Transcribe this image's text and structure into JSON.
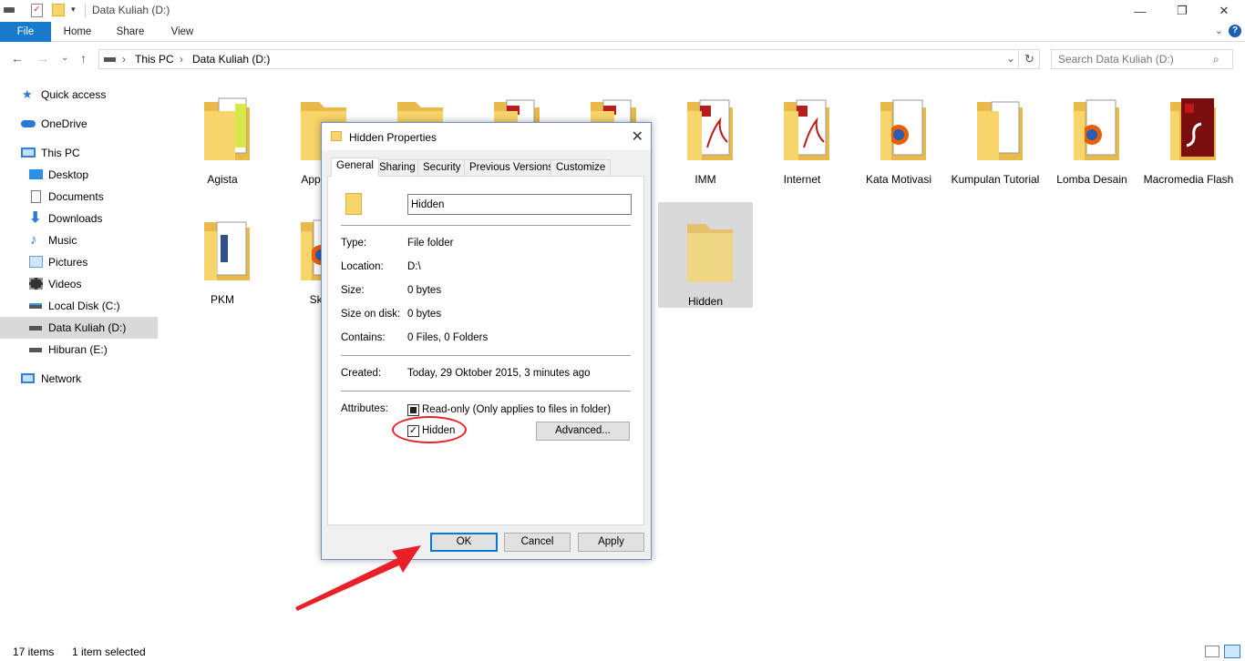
{
  "window": {
    "title": "Data Kuliah (D:)"
  },
  "ribbon": {
    "tabs": [
      "File",
      "Home",
      "Share",
      "View"
    ]
  },
  "address": {
    "crumbs": [
      "This PC",
      "Data Kuliah (D:)"
    ],
    "search_placeholder": "Search Data Kuliah (D:)"
  },
  "sidebar": {
    "items": [
      {
        "label": "Quick access",
        "icon": "star-icon"
      },
      {
        "label": "OneDrive",
        "icon": "cloud-icon"
      },
      {
        "label": "This PC",
        "icon": "computer-icon"
      },
      {
        "label": "Desktop",
        "icon": "desktop-icon"
      },
      {
        "label": "Documents",
        "icon": "documents-icon"
      },
      {
        "label": "Downloads",
        "icon": "download-icon"
      },
      {
        "label": "Music",
        "icon": "music-icon"
      },
      {
        "label": "Pictures",
        "icon": "pictures-icon"
      },
      {
        "label": "Videos",
        "icon": "videos-icon"
      },
      {
        "label": "Local Disk (C:)",
        "icon": "drive-icon"
      },
      {
        "label": "Data Kuliah (D:)",
        "icon": "drive-icon"
      },
      {
        "label": "Hiburan (E:)",
        "icon": "drive-icon"
      },
      {
        "label": "Network",
        "icon": "network-icon"
      }
    ],
    "selected": "Data Kuliah (D:)"
  },
  "files": [
    {
      "name": "Agista"
    },
    {
      "name": "Applica"
    },
    {
      "name": ""
    },
    {
      "name": ""
    },
    {
      "name": ""
    },
    {
      "name": "IMM"
    },
    {
      "name": "Internet"
    },
    {
      "name": "Kata Motivasi"
    },
    {
      "name": "Kumpulan Tutorial"
    },
    {
      "name": "Lomba Desain"
    },
    {
      "name": "Macromedia Flash"
    },
    {
      "name": "PKM"
    },
    {
      "name": "Skri"
    },
    {
      "name": "Hidden"
    }
  ],
  "status": {
    "count": "17 items",
    "selection": "1 item selected"
  },
  "dialog": {
    "title": "Hidden Properties",
    "tabs": [
      "General",
      "Sharing",
      "Security",
      "Previous Versions",
      "Customize"
    ],
    "name_value": "Hidden",
    "rows": [
      {
        "label": "Type:",
        "value": "File folder"
      },
      {
        "label": "Location:",
        "value": "D:\\"
      },
      {
        "label": "Size:",
        "value": "0 bytes"
      },
      {
        "label": "Size on disk:",
        "value": "0 bytes"
      },
      {
        "label": "Contains:",
        "value": "0 Files, 0 Folders"
      },
      {
        "label": "Created:",
        "value": "Today, 29 Oktober 2015, 3 minutes ago"
      }
    ],
    "attributes_label": "Attributes:",
    "readonly_label": "Read-only (Only applies to files in folder)",
    "hidden_label": "Hidden",
    "hidden_checked": true,
    "advanced_label": "Advanced...",
    "ok_label": "OK",
    "cancel_label": "Cancel",
    "apply_label": "Apply"
  },
  "colors": {
    "accent": "#1979ca",
    "folder": "#f7d56a",
    "annotation": "#e8202a"
  }
}
